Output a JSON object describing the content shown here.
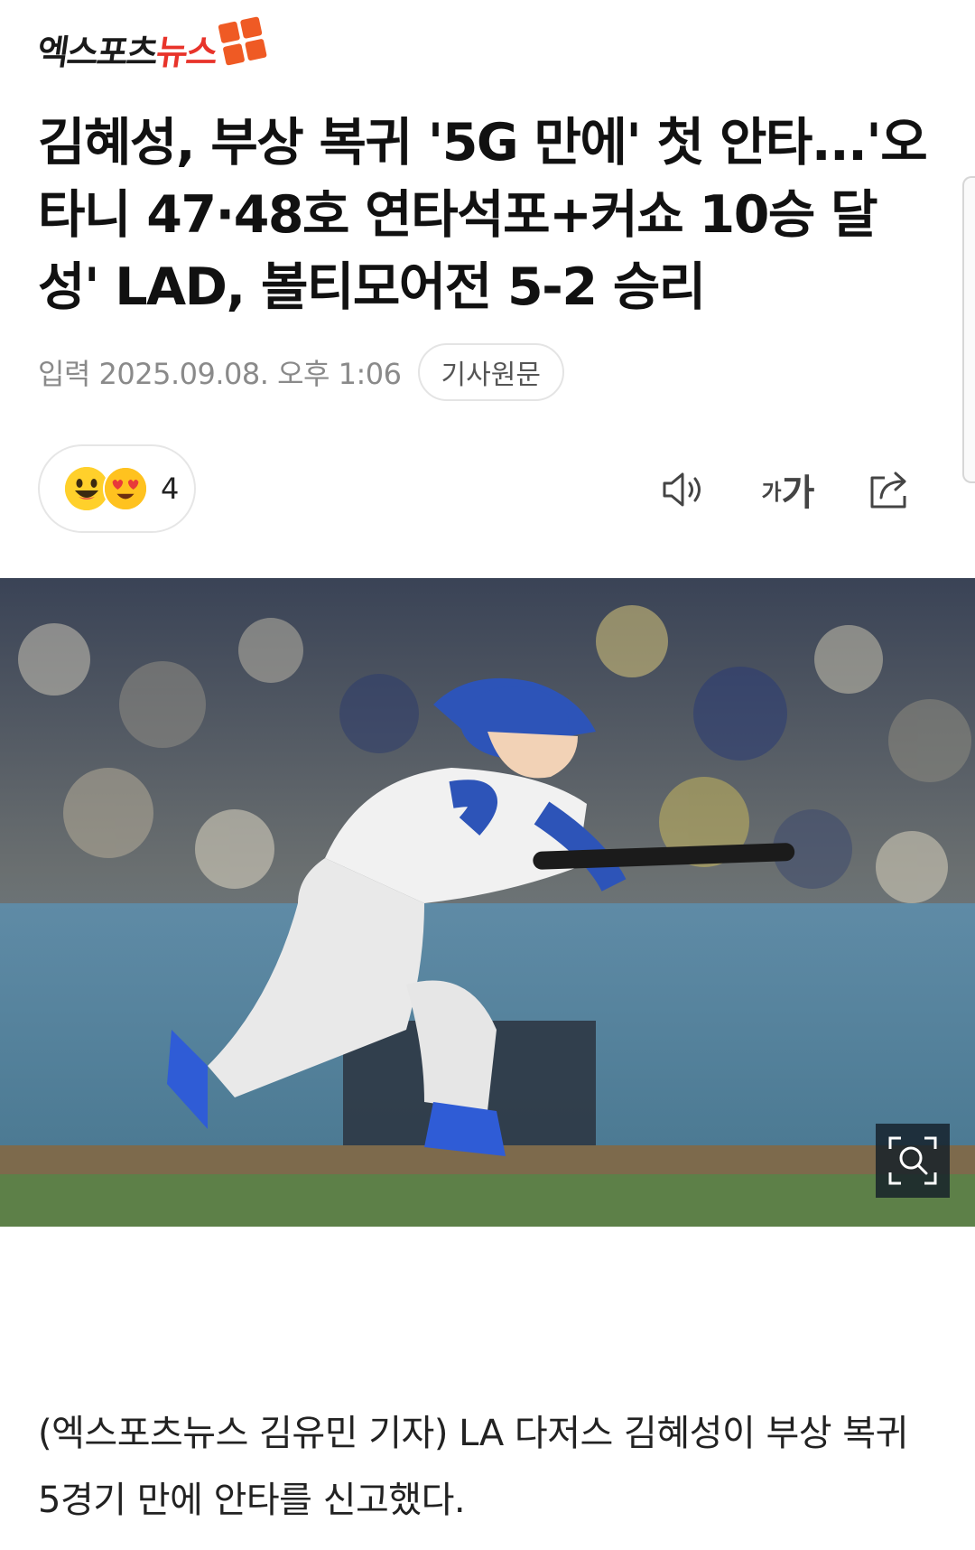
{
  "brand": {
    "logo_prefix": "엑스포츠",
    "logo_suffix": "뉴스"
  },
  "article": {
    "headline": "김혜성, 부상 복귀 '5G 만에' 첫 안타...'오타니 47·48호 연타석포+커쇼 10승 달성' LAD, 볼티모어전 5-2 승리",
    "published": "입력 2025.09.08. 오후 1:06",
    "source_button": "기사원문",
    "reaction_count": "4",
    "font_size_label_small": "가",
    "font_size_label_big": "가",
    "body": "(엑스포츠뉴스 김유민 기자) LA 다저스 김혜성이 부상 복귀 5경기 만에 안타를 신고했다."
  },
  "icons": {
    "reaction_1": "grinning-face-icon",
    "reaction_2": "heart-eyes-face-icon",
    "tts": "speaker-icon",
    "font_size": "font-size-icon",
    "share": "share-icon",
    "zoom": "zoom-icon"
  },
  "colors": {
    "logo_accent": "#ef5a24",
    "logo_red": "#e8332a",
    "meta_gray": "#8a8a8a",
    "emoji_yellow": "#ffd02b"
  }
}
